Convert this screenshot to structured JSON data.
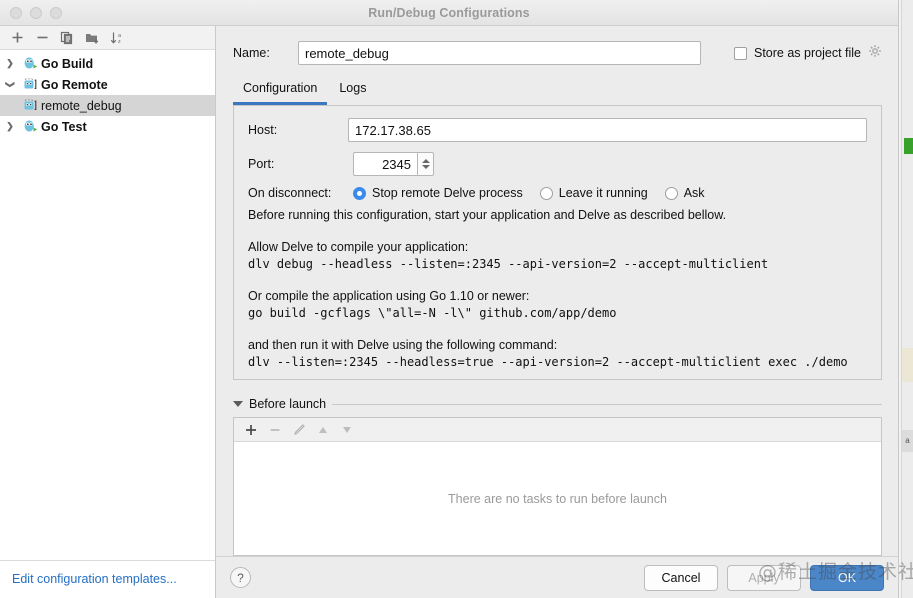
{
  "window": {
    "title": "Run/Debug Configurations",
    "traffic_lights": [
      "close",
      "minimize",
      "zoom"
    ]
  },
  "sidebar": {
    "toolbar": [
      {
        "name": "add",
        "label": "+"
      },
      {
        "name": "remove",
        "label": "−"
      },
      {
        "name": "copy",
        "label": "Copy Configuration"
      },
      {
        "name": "save-folder",
        "label": "Move into new folder"
      },
      {
        "name": "sort-alphabetically",
        "label": "Sort configurations"
      }
    ],
    "tree": [
      {
        "label": "Go Build",
        "type": "group",
        "expanded": false,
        "selected": false,
        "icon": "go-build-icon"
      },
      {
        "label": "Go Remote",
        "type": "group",
        "expanded": true,
        "selected": false,
        "icon": "go-remote-icon"
      },
      {
        "label": "remote_debug",
        "type": "item",
        "expanded": null,
        "selected": true,
        "icon": "go-remote-icon"
      },
      {
        "label": "Go Test",
        "type": "group",
        "expanded": false,
        "selected": false,
        "icon": "go-test-icon"
      }
    ],
    "edit_templates_link": "Edit configuration templates..."
  },
  "form": {
    "name_label": "Name:",
    "name_value": "remote_debug",
    "name_placeholder": "",
    "store_as_project_file_label": "Store as project file",
    "store_as_project_file_checked": false,
    "store_gear_icon": "gear-icon"
  },
  "tabs": [
    {
      "label": "Configuration",
      "active": true
    },
    {
      "label": "Logs",
      "active": false
    }
  ],
  "configuration": {
    "host_label": "Host:",
    "host_value": "172.17.38.65",
    "port_label": "Port:",
    "port_value": "2345",
    "on_disconnect_label": "On disconnect:",
    "on_disconnect_options": [
      {
        "label": "Stop remote Delve process",
        "selected": true
      },
      {
        "label": "Leave it running",
        "selected": false
      },
      {
        "label": "Ask",
        "selected": false
      }
    ],
    "intro_text": "Before running this configuration, start your application and Delve as described bellow.",
    "section_1_title": "Allow Delve to compile your application:",
    "section_1_command": "dlv debug --headless --listen=:2345 --api-version=2 --accept-multiclient",
    "section_2_title": "Or compile the application using Go 1.10 or newer:",
    "section_2_command": "go build -gcflags \\\"all=-N -l\\\" github.com/app/demo",
    "section_3_title": "and then run it with Delve using the following command:",
    "section_3_command": "dlv --listen=:2345 --headless=true --api-version=2 --accept-multiclient exec ./demo"
  },
  "before_launch": {
    "title": "Before launch",
    "expanded": true,
    "toolbar": [
      {
        "name": "add-task",
        "label": "+",
        "enabled": true
      },
      {
        "name": "remove-task",
        "label": "−",
        "enabled": false
      },
      {
        "name": "edit-task",
        "label": "edit",
        "enabled": false
      },
      {
        "name": "move-up-task",
        "label": "up",
        "enabled": false
      },
      {
        "name": "move-down-task",
        "label": "down",
        "enabled": false
      }
    ],
    "empty_text": "There are no tasks to run before launch"
  },
  "footer": {
    "help_label": "?",
    "cancel_label": "Cancel",
    "apply_label": "Apply",
    "apply_enabled": false,
    "ok_label": "OK"
  },
  "watermark": {
    "text": "@稀土掘金技术社区"
  },
  "colors": {
    "accent": "#3c78c0",
    "primary_button": "#4a86c8",
    "link": "#2470c4",
    "selected_row": "#d5d5d5",
    "radio_checked": "#3b8beb"
  }
}
